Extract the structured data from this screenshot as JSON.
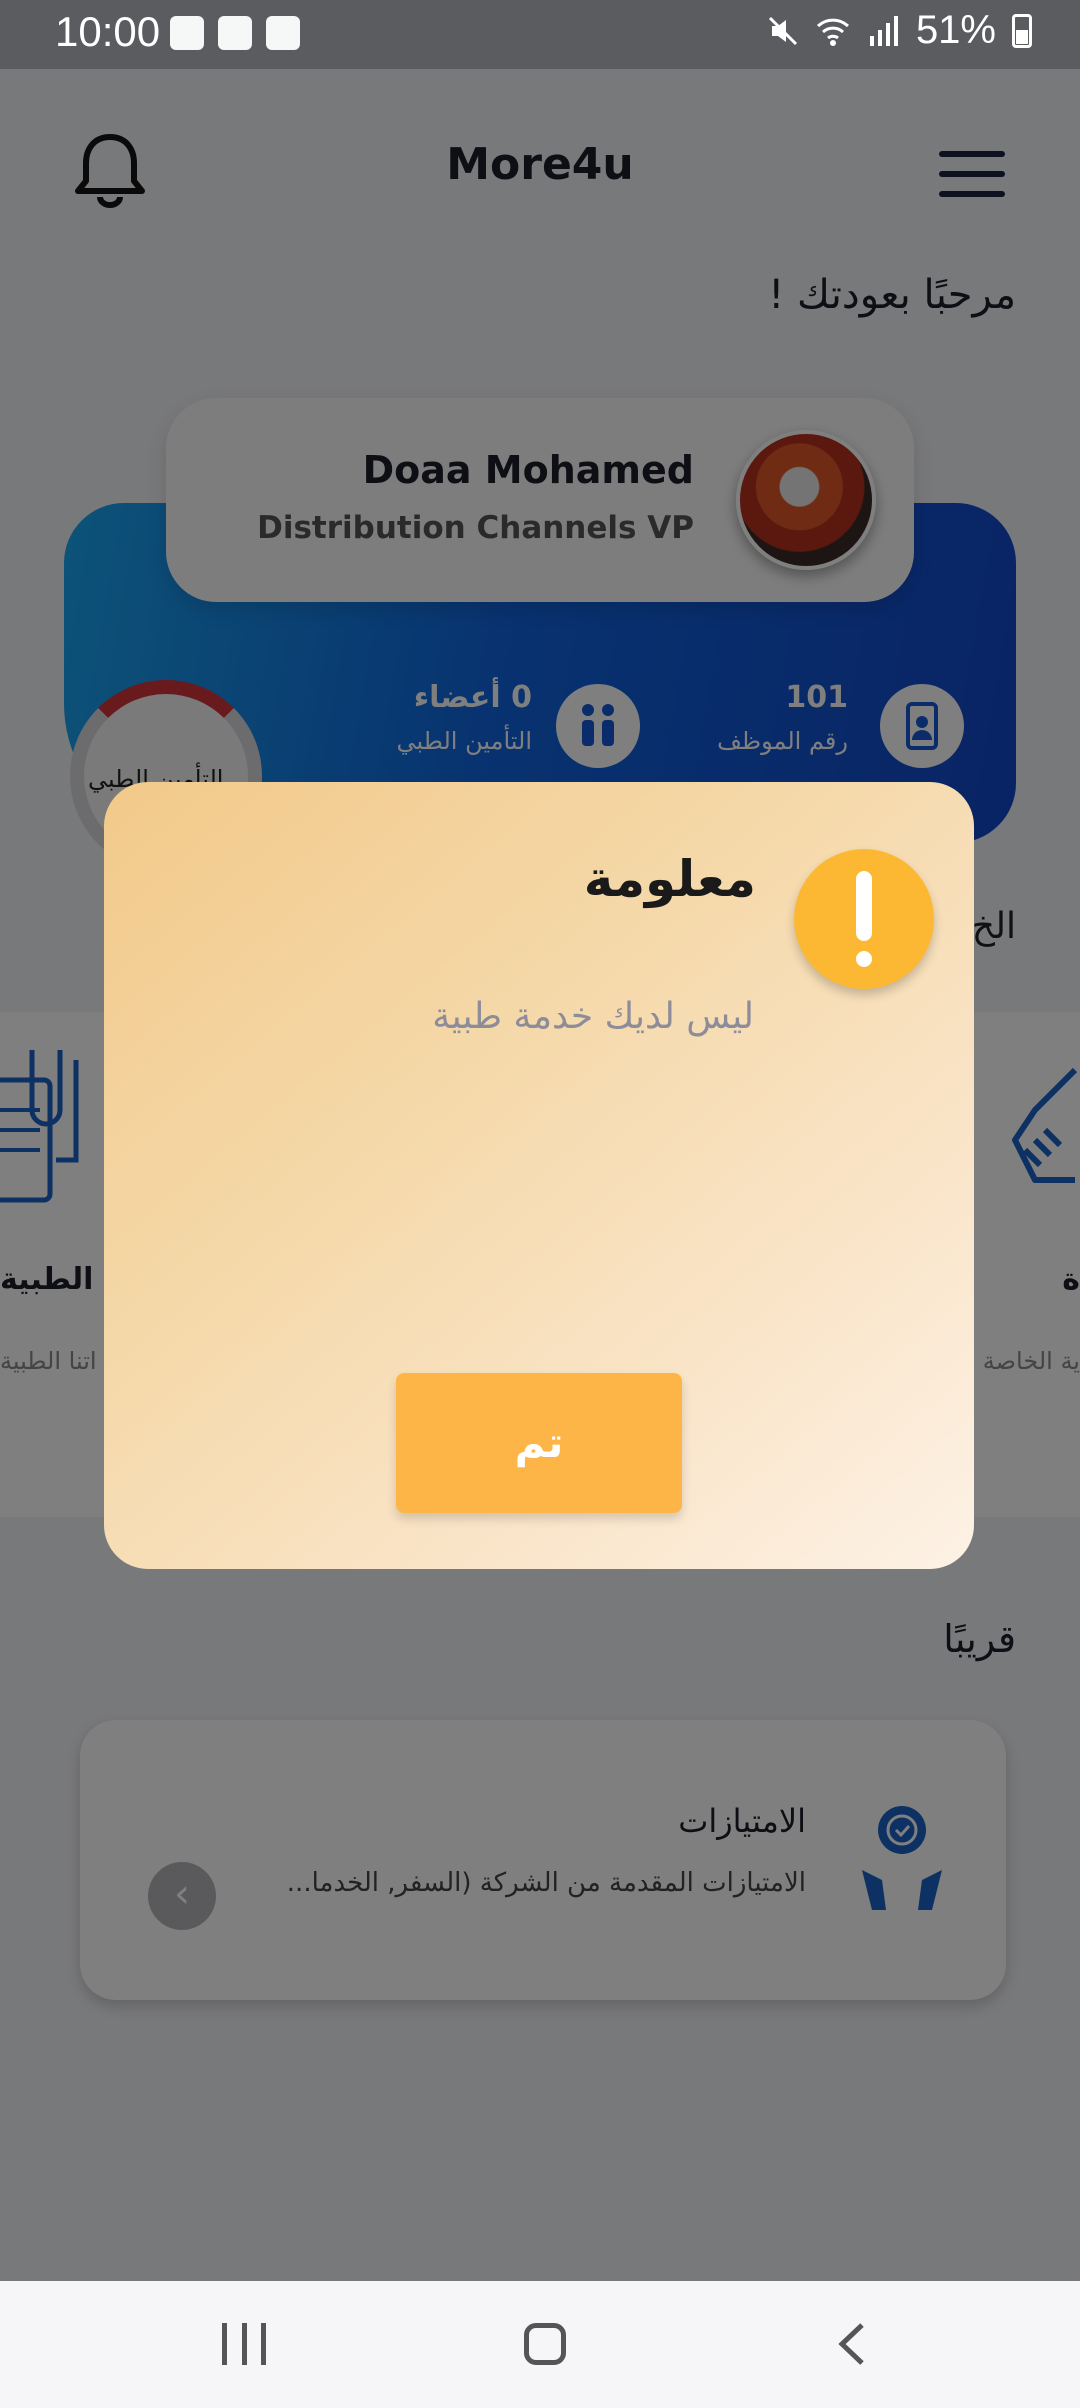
{
  "status_bar": {
    "time": "10:00",
    "battery": "51%"
  },
  "header": {
    "title": "More4u",
    "icons": [
      "bell-icon",
      "menu-icon"
    ]
  },
  "welcome_text": "مرحبًا بعودتك !",
  "profile": {
    "name": "Doaa Mohamed",
    "role": "Distribution Channels VP"
  },
  "stats": [
    {
      "value": "101",
      "label": "رقم الموظف",
      "icon": "employee-badge-icon"
    },
    {
      "value": "0 أعضاء",
      "label": "التأمين الطبي",
      "icon": "family-icon"
    }
  ],
  "gauge_label": "التأمين الطبي",
  "section_heading_partial": "الخ",
  "services": {
    "left_title": "ت الطبية",
    "left_subtitle": "اتنا الطبية",
    "right_title": "ة",
    "right_subtitle": "ية الخاصة"
  },
  "soon_heading": "قريبًا",
  "privileges": {
    "title": "الامتيازات",
    "subtitle": "الامتيازات المقدمة من الشركة (السفر, الخدما...",
    "arrow": "‹"
  },
  "dialog": {
    "title": "معلومة",
    "message": "ليس لديك خدمة طبية",
    "button_label": "تم",
    "colors": {
      "badge": "#fdb833",
      "button": "#feb548"
    }
  }
}
